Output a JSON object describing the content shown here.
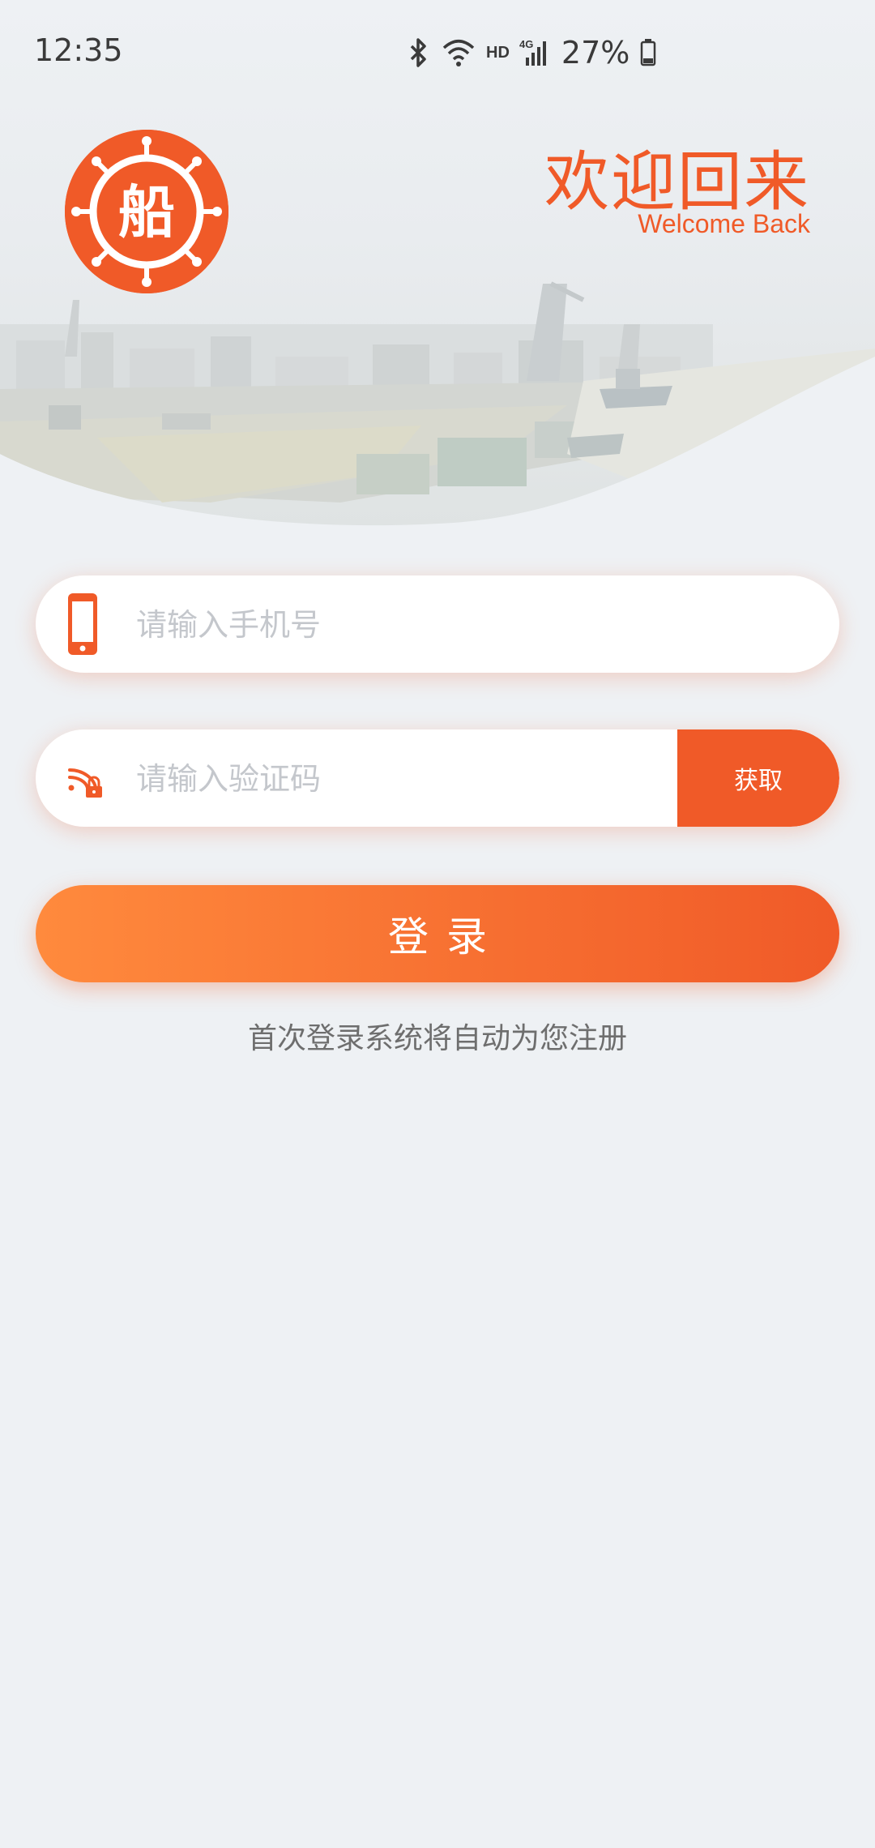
{
  "status_bar": {
    "time": "12:35",
    "network_badge": "HD",
    "signal_badge": "4G",
    "battery": "27%"
  },
  "header": {
    "logo_char": "船",
    "title": "欢迎回来",
    "subtitle": "Welcome Back"
  },
  "form": {
    "phone_placeholder": "请输入手机号",
    "phone_value": "",
    "code_placeholder": "请输入验证码",
    "code_value": "",
    "get_code_label": "获取",
    "login_label": "登录",
    "hint": "首次登录系统将自动为您注册"
  },
  "colors": {
    "accent": "#f05a28",
    "gradient_start": "#ff8a3d",
    "background": "#eef1f4",
    "placeholder": "#c4c7cc"
  },
  "icons": {
    "logo": "ship-wheel-icon",
    "phone": "phone-icon",
    "code": "lock-signal-icon",
    "bluetooth": "bluetooth-icon",
    "wifi": "wifi-icon",
    "signal": "signal-icon",
    "battery": "battery-icon"
  }
}
